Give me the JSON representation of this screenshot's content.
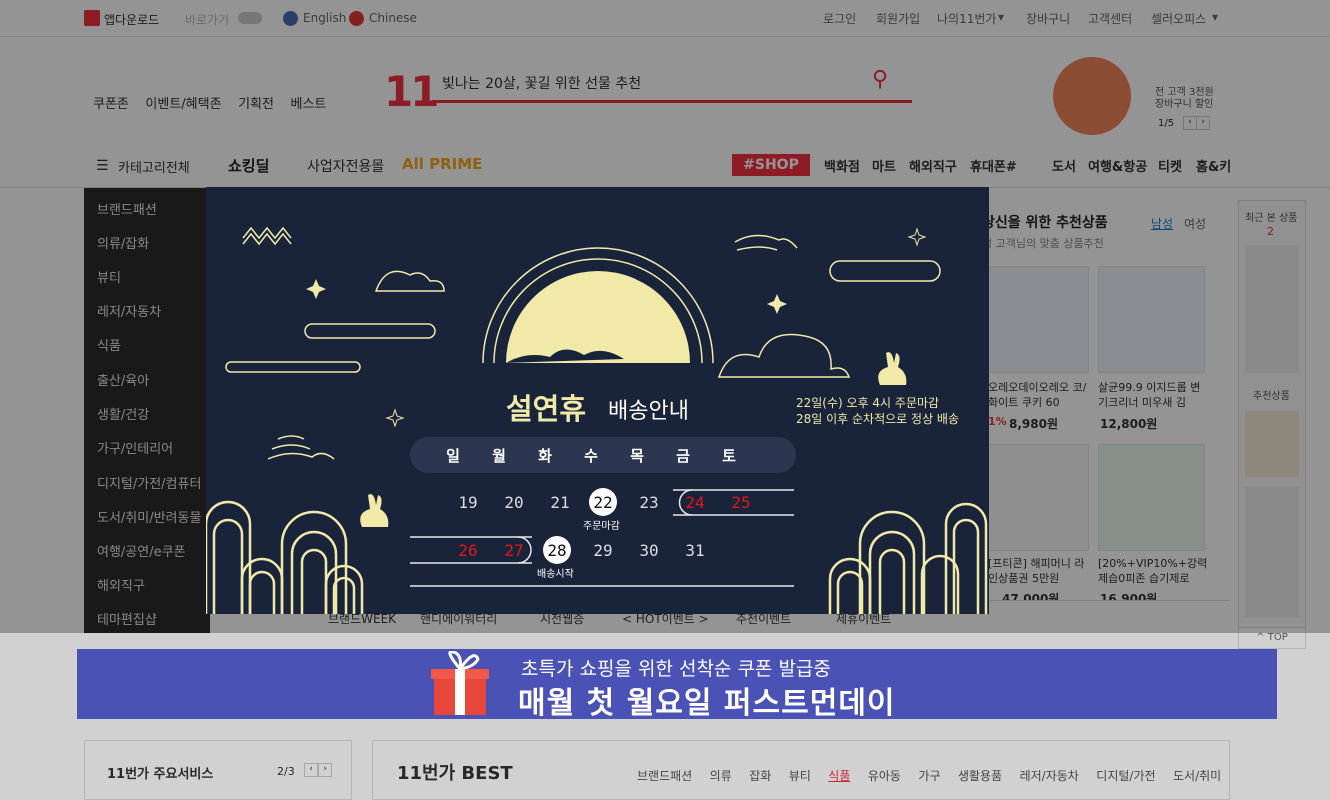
{
  "topbar": {
    "app_label": "앱다운로드",
    "shortcut_label": "바로가기",
    "lang_english": "English",
    "lang_chinese": "Chinese",
    "login": "로그인",
    "signup": "회원가입",
    "my11": "나의11번가",
    "cart": "장바구니",
    "help": "고객센터",
    "seller": "셀러오피스"
  },
  "header": {
    "nav": [
      "쿠폰존",
      "이벤트/혜택존",
      "기획전",
      "베스트"
    ],
    "search_placeholder": "빛나는 20살, 꽃길 위한 선물 추천",
    "promo_line1": "전 고객 3천원",
    "promo_line2": "장바구니 할인",
    "promo_page": "1/5"
  },
  "gnb": {
    "all_categories": "카테고리전체",
    "shocking": "쇼킹딜",
    "business": "사업자전용몰",
    "prime": "All PRIME",
    "shop": "#SHOP",
    "items": [
      "백화점",
      "마트",
      "해외직구",
      "휴대폰#",
      "도서",
      "여행&항공",
      "티켓",
      "홈&키"
    ]
  },
  "categories": [
    "브랜드패션",
    "의류/잡화",
    "뷰티",
    "레저/자동차",
    "식품",
    "출산/육아",
    "생활/건강",
    "가구/인테리어",
    "디지털/가전/컴퓨터",
    "도서/취미/반려동물",
    "여행/공연/e쿠폰",
    "해외직구",
    "테마편집샵"
  ],
  "recommend": {
    "title": "당신을 위한 추천상품",
    "subtitle": "성 고객님의 맞춤 상품추천",
    "male": "남성",
    "female": "여성",
    "items": [
      {
        "name": "오레오데이오레오 코/화이트 쿠키 60",
        "price": "8,980원",
        "discount": "1%"
      },
      {
        "name": "살균99.9 이지드롭 변기크리너 미우새 김",
        "price": "12,800원",
        "discount": ""
      },
      {
        "name": "[프티콘] 해피머니 라인상품권 5만원",
        "price": "47,000원",
        "discount": ""
      },
      {
        "name": "[20%+VIP10%+강력제습0피존 습기제로",
        "price": "16,900원",
        "discount": ""
      }
    ]
  },
  "recent": {
    "title": "최근 본 상품",
    "count": "2",
    "recommend_label": "추천상품",
    "top": "TOP"
  },
  "tabs": [
    "브랜드WEEK",
    "핸디에이워터리",
    "시전웹증",
    "< HOT이벤트 >",
    "추천이벤트",
    "제휴이벤트"
  ],
  "modal": {
    "title_bold": "설연휴",
    "title_light": "배송안내",
    "notice1": "22일(수) 오후 4시 주문마감",
    "notice2": "28일 이후 순차적으로 정상 배송",
    "weekdays": [
      "일",
      "월",
      "화",
      "수",
      "목",
      "금",
      "토"
    ],
    "week1": [
      "19",
      "20",
      "21",
      "22",
      "23",
      "24",
      "25"
    ],
    "week2": [
      "26",
      "27",
      "28",
      "29",
      "30",
      "31"
    ],
    "deadline_label": "주문마감",
    "restart_label": "배송시작"
  },
  "banner": {
    "line1": "초특가 쇼핑을 위한 선착순 쿠폰 발급중",
    "line2": "매월 첫 월요일 퍼스트먼데이"
  },
  "bottom": {
    "services_title": "11번가 주요서비스",
    "services_page": "2/3",
    "best_title": "11번가 BEST",
    "best_tabs": [
      "브랜드패션",
      "의류",
      "잡화",
      "뷰티",
      "식품",
      "유아동",
      "가구",
      "생활용품",
      "레저/자동차",
      "디지털/가전",
      "도서/취미"
    ]
  },
  "colors": {
    "modal_bg": "#19243b",
    "moon": "#f1e9a8",
    "banner_bg": "#4a52b6",
    "red": "#e01818",
    "brand": "#f43142"
  }
}
